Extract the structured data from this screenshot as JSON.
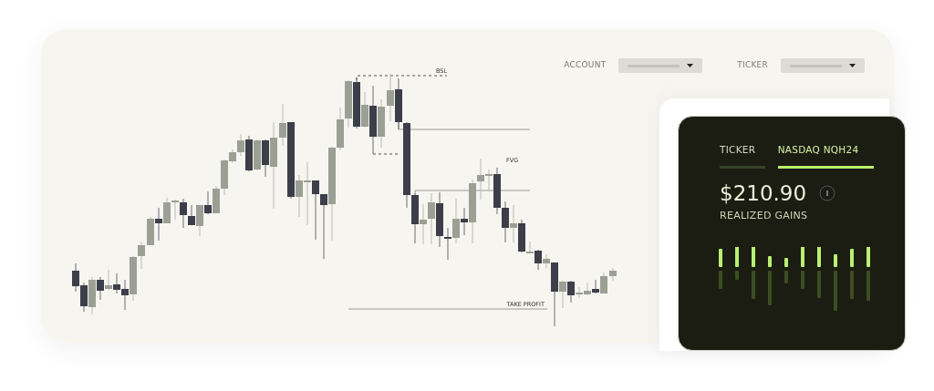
{
  "chart": {
    "labels": [
      {
        "kind": "bsl",
        "text": "BSL"
      },
      {
        "kind": "fvg",
        "text": "FVG"
      },
      {
        "kind": "take_profit",
        "text": "TAKE PROFIT"
      }
    ]
  },
  "filters": [
    {
      "label": "ACCOUNT"
    },
    {
      "label": "TICKER"
    }
  ],
  "card": {
    "tabs": [
      {
        "label": "TICKER",
        "selected": false
      },
      {
        "label": "NASDAQ NQH24",
        "selected": true
      }
    ],
    "amount": "$210.90",
    "caption": "REALIZED GAINS"
  }
}
